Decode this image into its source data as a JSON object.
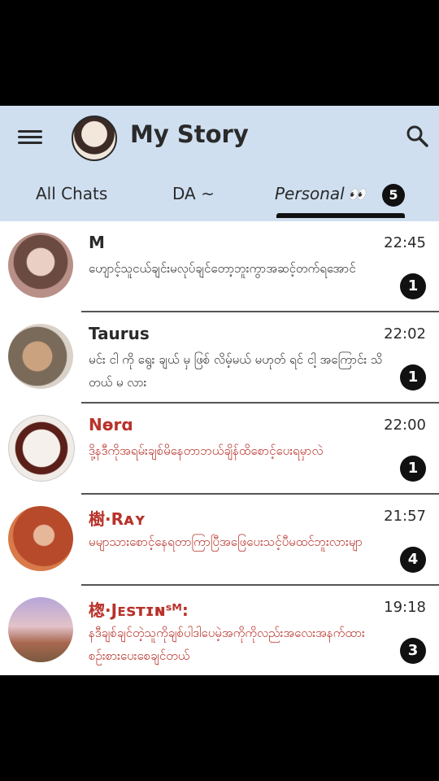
{
  "header": {
    "title": "My Story",
    "menu_icon": "hamburger-menu-icon",
    "search_icon": "search-icon"
  },
  "tabs": [
    {
      "label": "All Chats"
    },
    {
      "label": "DA ~"
    },
    {
      "label": "Personal",
      "emoji": "👀",
      "badge": "5",
      "active": true
    }
  ],
  "chats": [
    {
      "name": "M",
      "time": "22:45",
      "message": "ဟျောင့်သူငယ်ချင်းမလုပ်ချင်တော့ဘူးကွာအဆင့်တက်ရအောင်",
      "unread": "1"
    },
    {
      "name": "Taurus",
      "time": "22:02",
      "message": "မင်း ငါ ကို ရွေး ချယ် မှ ဖြစ် လိမ့်မယ် မဟုတ် ရင် ငါ့ အကြောင်း သိ တယ် မ လား",
      "unread": "1"
    },
    {
      "name": "Nɵrɑ",
      "time": "22:00",
      "message": "ဒို့နဒီကိုအရမ်းချစ်မိနေတာဘယ်ချိန်ထိစောင့်ပေးရမှာလဲ",
      "unread": "1"
    },
    {
      "name": "樹·Rᴀʏ",
      "time": "21:57",
      "message": "မမျာသားစောင့်နေရတာကြာပြီအဖြေပေးသင့်ပီမထင်ဘူးလားမျာ",
      "unread": "4"
    },
    {
      "name": "楤·Jᴇsᴛɪɴˢᴹ:",
      "time": "19:18",
      "message": "နဒီချစ်ချင်တဲ့သူကိုချစ်ပါဒါပေမဲ့အကိုကိုလည်းအလေးအနက်ထားစဉ်းစားပေးစေချင်တယ်",
      "unread": "3"
    }
  ]
}
